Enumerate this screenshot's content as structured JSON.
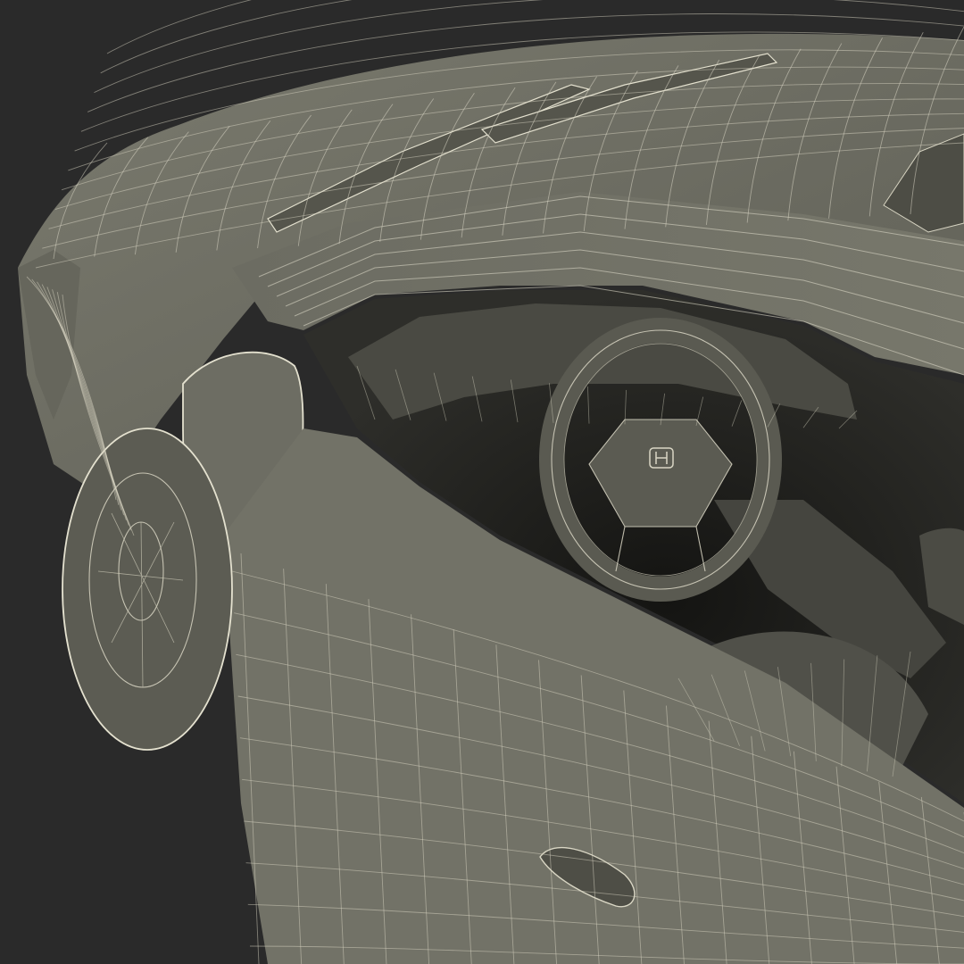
{
  "scene": {
    "background_color": "#2a2a2a",
    "body_color": "#6f6f64",
    "body_dark_color": "#55554c",
    "interior_color": "#3a3a35",
    "cabin_shadow_color": "#1e1e1b",
    "wire_color": "#d9d6c4"
  },
  "icons": {
    "steering_emblem": "h-emblem-icon"
  }
}
